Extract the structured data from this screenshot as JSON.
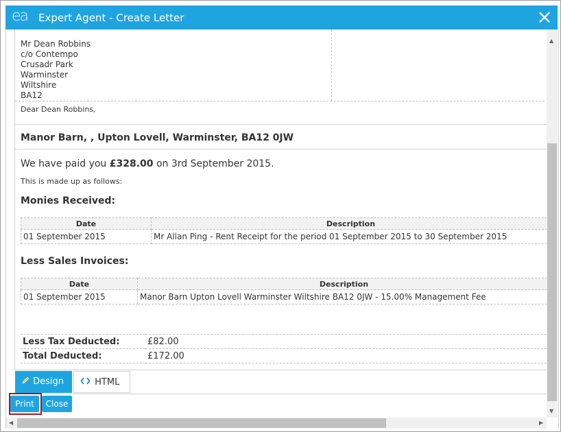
{
  "window": {
    "logo": "ea",
    "title": "Expert Agent - Create Letter",
    "close_icon": "×"
  },
  "letter": {
    "address_lines": [
      "Mr Dean Robbins",
      "c/o Contempo",
      "Crusadr Park",
      "Warminster",
      "Wiltshire",
      "BA12"
    ],
    "salutation": "Dear Dean Robbins,",
    "property": "Manor Barn, , Upton Lovell, Warminster, BA12 0JW",
    "paid_prefix": "We have paid you ",
    "paid_amount": "£328.00",
    "paid_suffix": " on 3rd September 2015.",
    "made_up": "This is made up as follows:",
    "monies_heading": "Monies Received:",
    "monies_table": {
      "headers": [
        "Date",
        "Description"
      ],
      "rows": [
        [
          "01 September 2015",
          "Mr Allan Ping - Rent Receipt for the period 01 September 2015 to 30 September 2015"
        ]
      ]
    },
    "invoices_heading": "Less Sales Invoices:",
    "invoices_table": {
      "headers": [
        "Date",
        "Description"
      ],
      "rows": [
        [
          "01 September 2015",
          "Manor Barn Upton Lovell Warminster Wiltshire BA12 0JW - 15.00% Management Fee"
        ]
      ]
    },
    "totals": [
      {
        "label": "Less Tax Deducted:",
        "value": "£82.00"
      },
      {
        "label": "Total Deducted:",
        "value": "£172.00"
      }
    ]
  },
  "editor_tabs": {
    "design_label": "Design",
    "html_label": "HTML",
    "design_icon": "pencil-icon",
    "html_icon": "code-icon"
  },
  "actions": {
    "print_label": "Print",
    "close_label": "Close"
  },
  "colors": {
    "accent": "#1ea5e0",
    "highlight": "#b5121b"
  }
}
